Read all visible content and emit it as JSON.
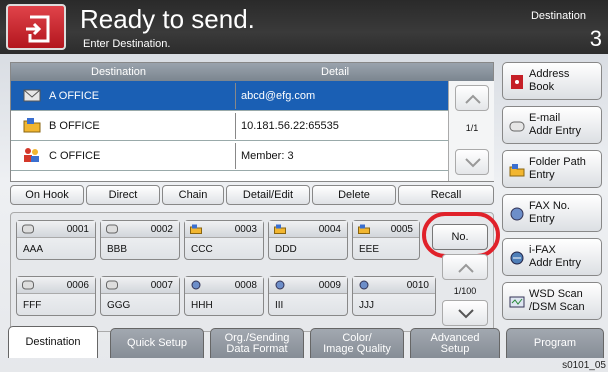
{
  "header": {
    "title": "Ready to send.",
    "subtitle": "Enter Destination.",
    "destination_label": "Destination",
    "destination_count": "3"
  },
  "list": {
    "col_destination": "Destination",
    "col_detail": "Detail",
    "rows": [
      {
        "name": "A OFFICE",
        "detail": "abcd@efg.com",
        "icon": "email-icon",
        "selected": true
      },
      {
        "name": "B OFFICE",
        "detail": "10.181.56.22:65535",
        "icon": "folder-icon",
        "selected": false
      },
      {
        "name": "C OFFICE",
        "detail": "Member:   3",
        "icon": "group-icon",
        "selected": false
      }
    ],
    "page": "1/1"
  },
  "actions": [
    "On Hook",
    "Direct",
    "Chain",
    "Detail/Edit",
    "Delete",
    "Recall"
  ],
  "keys": [
    {
      "num": "0001",
      "name": "AAA"
    },
    {
      "num": "0002",
      "name": "BBB"
    },
    {
      "num": "0003",
      "name": "CCC"
    },
    {
      "num": "0004",
      "name": "DDD"
    },
    {
      "num": "0005",
      "name": "EEE"
    },
    {
      "num": "0006",
      "name": "FFF"
    },
    {
      "num": "0007",
      "name": "GGG"
    },
    {
      "num": "0008",
      "name": "HHH"
    },
    {
      "num": "0009",
      "name": "III"
    },
    {
      "num": "0010",
      "name": "JJJ"
    }
  ],
  "no_button": "No.",
  "keys_page": "1/100",
  "right_buttons": [
    {
      "line1": "Address",
      "line2": "Book"
    },
    {
      "line1": "E-mail",
      "line2": "Addr Entry"
    },
    {
      "line1": "Folder Path",
      "line2": "Entry"
    },
    {
      "line1": "FAX No.",
      "line2": "Entry"
    },
    {
      "line1": "i-FAX",
      "line2": "Addr Entry"
    },
    {
      "line1": "WSD Scan",
      "line2": "/DSM Scan"
    }
  ],
  "tabs": [
    {
      "line1": "Destination",
      "line2": ""
    },
    {
      "line1": "Quick Setup",
      "line2": ""
    },
    {
      "line1": "Org./Sending",
      "line2": "Data Format"
    },
    {
      "line1": "Color/",
      "line2": "Image Quality"
    },
    {
      "line1": "Advanced",
      "line2": "Setup"
    },
    {
      "line1": "Program",
      "line2": ""
    }
  ],
  "figure_code": "s0101_05",
  "colors": {
    "selected_row": "#1a5fb4",
    "home_button": "#c51f27",
    "highlight_ring": "#e0212a"
  }
}
